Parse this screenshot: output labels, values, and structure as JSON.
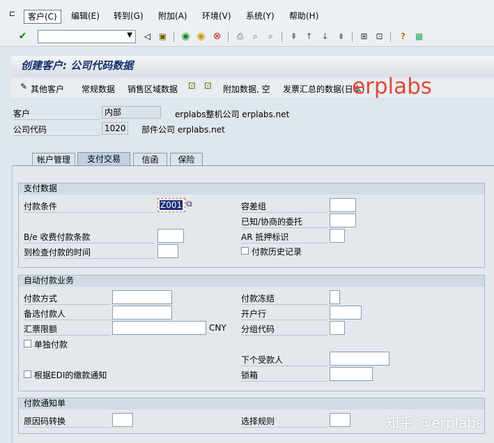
{
  "menubar": {
    "items": [
      "客户(C)",
      "编辑(E)",
      "转到(G)",
      "附加(A)",
      "环境(V)",
      "系统(Y)",
      "帮助(H)"
    ]
  },
  "toolbar": {
    "command_value": "",
    "icons": [
      "ok-icon",
      "command-dropdown-icon",
      "back-nav-icon",
      "save-icon",
      "back-icon",
      "exit-icon",
      "cancel-icon",
      "print-icon",
      "find-icon",
      "find-next-icon",
      "first-page-icon",
      "prev-page-icon",
      "next-page-icon",
      "last-page-icon",
      "new-session-icon",
      "shortcut-icon",
      "help-icon",
      "layout-icon"
    ]
  },
  "title": "创建客户: 公司代码数据",
  "app_toolbar": {
    "other_customer": "其他客户",
    "general_data": "常规数据",
    "sales_area_data": "销售区域数据",
    "additional_data_empty": "附加数据, 空",
    "invoice_summary": "发票汇总的数据(日本)"
  },
  "watermark": "erplabs",
  "header": {
    "customer_label": "客户",
    "customer_value": "内部",
    "customer_desc": "erplabs整机公司 erplabs.net",
    "company_code_label": "公司代码",
    "company_code_value": "1020",
    "company_code_desc": "部件公司 erplabs.net"
  },
  "tabs": [
    "帐户管理",
    "支付交易",
    "信函",
    "保险"
  ],
  "payment_data": {
    "title": "支付数据",
    "payment_terms_label": "付款条件",
    "payment_terms_value": "Z001",
    "tolerance_group_label": "容差组",
    "known_negotiated_leave_label": "已知/协商的委托",
    "be_payment_terms_label": "B/e 收费付款条款",
    "ar_pledge_label": "AR 抵押标识",
    "check_time_label": "到检查付款的时间",
    "payment_history_label": "付款历史记录"
  },
  "auto_payment": {
    "title": "自动付款业务",
    "payment_methods_label": "付款方式",
    "payment_block_label": "付款冻结",
    "alt_payer_label": "备选付款人",
    "house_bank_label": "开户行",
    "bill_limit_label": "汇票限额",
    "currency": "CNY",
    "grouping_key_label": "分组代码",
    "individual_payment_label": "单独付款",
    "next_payee_label": "下个受款人",
    "edi_label": "根据EDI的缴款通知",
    "lockbox_label": "锁箱"
  },
  "payment_advice": {
    "title": "付款通知单",
    "reason_code_label": "原因码转换",
    "selection_rule_label": "选择规则"
  },
  "footer_watermark": "知乎 @erplabs"
}
